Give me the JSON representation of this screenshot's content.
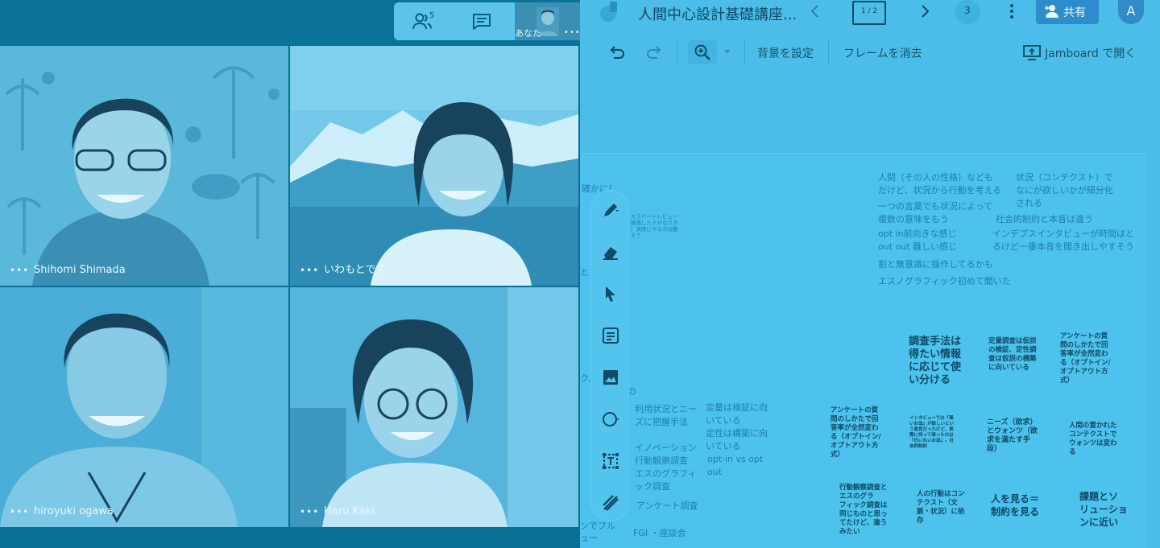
{
  "meet": {
    "people_count": "5",
    "self_label": "あなた",
    "dots": "•••",
    "participants": [
      {
        "name": "Shihomi Shimada"
      },
      {
        "name": "いわもとです"
      },
      {
        "name": "hiroyuki ogawa"
      },
      {
        "name": "Haru Kaki"
      }
    ]
  },
  "jamboard": {
    "title": "人間中心設計基礎講座...",
    "frame_indicator": "1 / 2",
    "frame_count": "3",
    "share_label": "共有",
    "avatar_letter": "A",
    "toolbar": {
      "set_background": "背景を設定",
      "clear_frame": "フレームを消去",
      "open_in_jamboard": "Jamboard で開く"
    },
    "canvas": {
      "left_fragments": [
        "確かに！",
        "と",
        "ク、未",
        "めの",
        "ンでプル",
        "ュー"
      ],
      "left_small": "キスパートレビュー\n経過した人がなりき\n）実際にやるのは難\nそう",
      "left_sticky": [
        "利用状況とニー\nズに把握手法",
        "定量は検証に向\nいている\n定性は構築に向\nいている",
        "イノベーション\n行動観察調査\nエスのグラフィ\nック調査",
        "opt-in vs opt\nout",
        "アンケート調査",
        "FGI ・座談会"
      ],
      "right_lines": [
        "人間（その人の性格）なども\nだけど、状況から行動を考える",
        "状況（コンテクスト）で\nなにが欲しいかが細分化\nされる",
        "一つの言葉でも状況によって\n複数の意味をもう",
        "社会的制約と本音は違う",
        "opt in前向きな感じ\nout out 難しい感じ",
        "インデプスインタビューが時間はと\nるけど一番本音を聞き出しやすそう",
        "割と無意識に操作してるかも",
        "エスノグラフィック初めて聞いた"
      ],
      "notes": [
        {
          "text": "調査手法は\n得たい情報\nに応じて使\nい分ける"
        },
        {
          "text": "定量調査は仮説\nの検証、定性調\n査は仮説の構築\nに向いている"
        },
        {
          "text": "アンケートの質\n問のしかたで回\n答率が全然変わ\nる（オプトイン/\nオプトアウト方\n式）"
        },
        {
          "text": "アンケートの質\n問のしかたで回\n答率が全然変わ\nる（オプトイン/\nオプトアウト方\n式）"
        },
        {
          "text": "インタビューでは『黒\nいお皿』が欲しいとい\nう意見だったけど、実\n際に持って帰ったのは\n『白い丸いお皿』。社\n会的制約"
        },
        {
          "text": "ニーズ（欲求）\nとウォンツ（欲\n求を満たす手\n段）"
        },
        {
          "text": "人間の置かれた\nコンテクストで\nウォンツは変わ\nる"
        },
        {
          "text": "行動観察調査と\nエスのグラ\nフィック調査は\n同じものと思っ\nてたけど、違う\nみたい"
        },
        {
          "text": "人の行動はコン\nテクスト（文\n脈・状況）に依\n存"
        },
        {
          "text": "人を見る＝\n制約を見る"
        },
        {
          "text": "課題とソ\nリューショ\nンに近い"
        }
      ]
    }
  },
  "colors": {
    "accent": "#2c8ccc",
    "overlay": "#4bbde8"
  }
}
